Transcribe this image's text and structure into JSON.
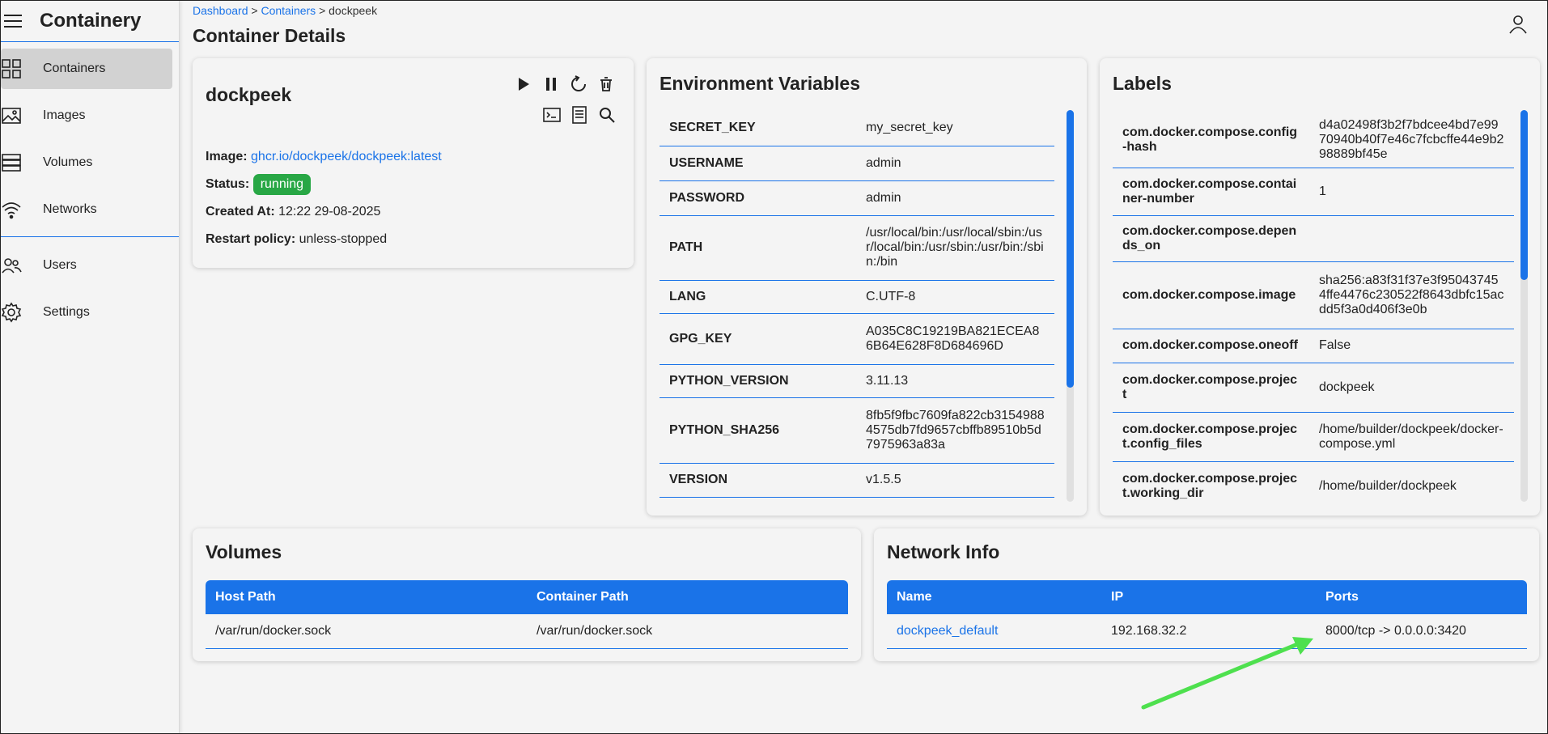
{
  "app": {
    "title": "Containery"
  },
  "sidebar": {
    "items": [
      {
        "label": "Containers",
        "icon": "grid-icon",
        "active": true
      },
      {
        "label": "Images",
        "icon": "image-icon"
      },
      {
        "label": "Volumes",
        "icon": "database-icon"
      },
      {
        "label": "Networks",
        "icon": "wifi-icon"
      },
      {
        "label": "Users",
        "icon": "users-icon"
      },
      {
        "label": "Settings",
        "icon": "gear-icon"
      }
    ]
  },
  "breadcrumb": {
    "dashboard": "Dashboard",
    "containers": "Containers",
    "current": "dockpeek",
    "sep": ">"
  },
  "page": {
    "title": "Container Details"
  },
  "container": {
    "name": "dockpeek",
    "image_label": "Image:",
    "image": "ghcr.io/dockpeek/dockpeek:latest",
    "status_label": "Status:",
    "status": "running",
    "created_label": "Created At:",
    "created": "12:22 29-08-2025",
    "restart_label": "Restart policy:",
    "restart": "unless-stopped"
  },
  "env": {
    "title": "Environment Variables",
    "rows": [
      {
        "k": "SECRET_KEY",
        "v": "my_secret_key"
      },
      {
        "k": "USERNAME",
        "v": "admin"
      },
      {
        "k": "PASSWORD",
        "v": "admin"
      },
      {
        "k": "PATH",
        "v": "/usr/local/bin:/usr/local/sbin:/usr/local/bin:/usr/sbin:/usr/bin:/sbin:/bin"
      },
      {
        "k": "LANG",
        "v": "C.UTF-8"
      },
      {
        "k": "GPG_KEY",
        "v": "A035C8C19219BA821ECEA86B64E628F8D684696D"
      },
      {
        "k": "PYTHON_VERSION",
        "v": "3.11.13"
      },
      {
        "k": "PYTHON_SHA256",
        "v": "8fb5f9fbc7609fa822cb31549884575db7fd9657cbffb89510b5d7975963a83a"
      },
      {
        "k": "VERSION",
        "v": "v1.5.5"
      }
    ]
  },
  "labels": {
    "title": "Labels",
    "rows": [
      {
        "k": "com.docker.compose.config-hash",
        "v": "d4a02498f3b2f7bdcee4bd7e9970940b40f7e46c7fcbcffe44e9b298889bf45e"
      },
      {
        "k": "com.docker.compose.container-number",
        "v": "1"
      },
      {
        "k": "com.docker.compose.depends_on",
        "v": ""
      },
      {
        "k": "com.docker.compose.image",
        "v": "sha256:a83f31f37e3f950437454ffe4476c230522f8643dbfc15acdd5f3a0d406f3e0b"
      },
      {
        "k": "com.docker.compose.oneoff",
        "v": "False"
      },
      {
        "k": "com.docker.compose.project",
        "v": "dockpeek"
      },
      {
        "k": "com.docker.compose.project.config_files",
        "v": "/home/builder/dockpeek/docker-compose.yml"
      },
      {
        "k": "com.docker.compose.project.working_dir",
        "v": "/home/builder/dockpeek"
      }
    ]
  },
  "volumes": {
    "title": "Volumes",
    "headers": [
      "Host Path",
      "Container Path"
    ],
    "rows": [
      {
        "host": "/var/run/docker.sock",
        "container": "/var/run/docker.sock"
      }
    ]
  },
  "network": {
    "title": "Network Info",
    "headers": [
      "Name",
      "IP",
      "Ports"
    ],
    "rows": [
      {
        "name": "dockpeek_default",
        "ip": "192.168.32.2",
        "ports": "8000/tcp -> 0.0.0.0:3420"
      }
    ]
  },
  "colors": {
    "accent": "#1a73e8",
    "running": "#28a745",
    "arrow": "#4ee04e"
  }
}
